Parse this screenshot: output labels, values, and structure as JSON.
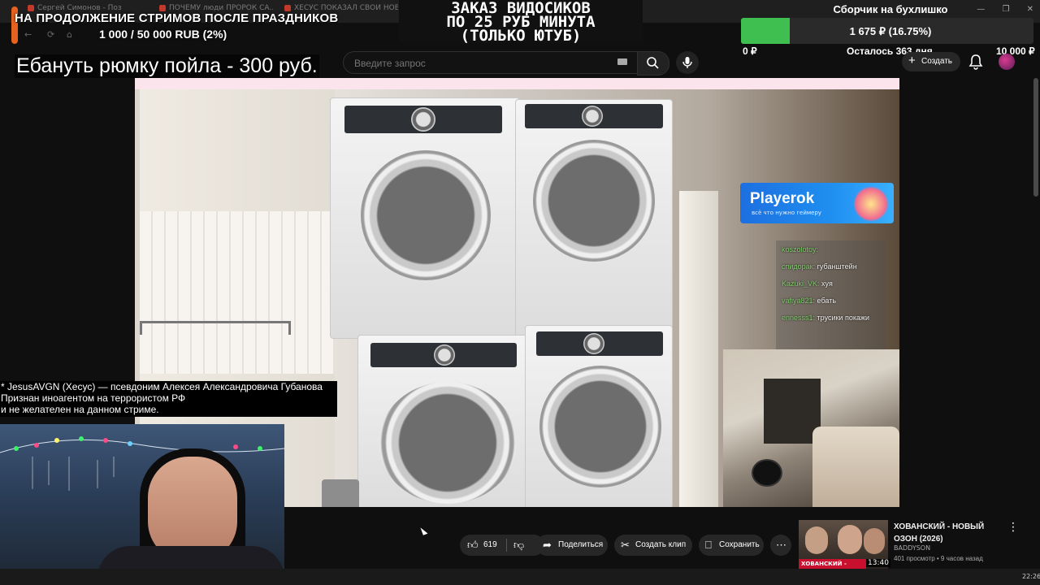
{
  "browser": {
    "tabs": [
      "Сергей Симонов - Позиция...",
      "ПОЧЕМУ люди ПРОРОК СА...",
      "ХЕСУС ПОКАЗАЛ СВОЙ НОВЫ..."
    ],
    "window_controls": [
      "—",
      "❐",
      "✕"
    ]
  },
  "overlay": {
    "stream_banner": "НА ПРОДОЛЖЕНИЕ СТРИМОВ ПОСЛЕ ПРАЗДНИКОВ",
    "goal_progress": "1 000 / 50 000 RUB (2%)",
    "order_lines": [
      "ЗАКАЗ ВИДОСИКОВ",
      "ПО 25 РУБ МИНУТА",
      "(ТОЛЬКО ЮТУБ)"
    ],
    "collector": {
      "title": "Сборчик на бухлишко",
      "amount": "1 675 ₽ (16.75%)",
      "fraction": 0.1675,
      "min": "0 ₽",
      "remaining": "Осталось 363 дня",
      "max": "10 000 ₽",
      "fill_color": "#3fbf50"
    },
    "pour_text": "Ебануть рюмку пойла - 300 руб.",
    "disclaimer": [
      "* JesusAVGN (Хесус) — псевдоним Алексея Александровича Губанова",
      "Признан иноагентом на террористом  РФ",
      "и не желателен на данном стриме."
    ]
  },
  "youtube": {
    "search_placeholder": "Введите запрос",
    "create_label": "Создать",
    "actions": {
      "likes": "619",
      "share": "Поделиться",
      "clip": "Создать клип",
      "save": "Сохранить",
      "more": "⋯"
    }
  },
  "ad": {
    "name": "Playerok",
    "tagline": "всё что нужно геймеру"
  },
  "chat": [
    {
      "user": "koszolotoy:",
      "text": ""
    },
    {
      "user": "спидорак:",
      "text": "губанштейн"
    },
    {
      "user": "Kazuki_VK:",
      "text": "хуя"
    },
    {
      "user": "vafiya821:",
      "text": "ебать"
    },
    {
      "user": "ennesss1:",
      "text": "трусики покажи"
    }
  ],
  "recommendation": {
    "title": "ХОВАНСКИЙ - НОВЫЙ ОЗОН (2026)",
    "channel": "BADDYSON",
    "meta": "401 просмотр • 9 часов назад",
    "duration": "13:40",
    "thumb_caption": "ХОВАНСКИЙ - НОВЫЙ"
  },
  "clock": "22:26"
}
